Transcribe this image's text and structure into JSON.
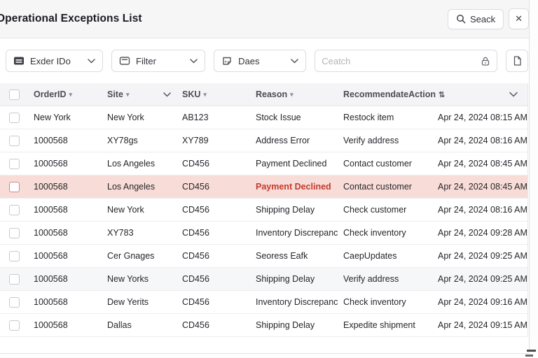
{
  "header": {
    "title": "Operational Exceptions List",
    "search_button": "Seack",
    "close_button": "✕"
  },
  "toolbar": {
    "dropdowns": [
      {
        "label": "Exder IDo",
        "icon": "list-icon"
      },
      {
        "label": "Filter",
        "icon": "filter-icon"
      },
      {
        "label": "Daes",
        "icon": "note-icon"
      }
    ],
    "search": {
      "placeholder": "Ceatch",
      "trailing_icon": "lock-icon"
    },
    "copy_button_icon": "file-icon"
  },
  "table": {
    "columns": [
      {
        "label": "OrderID",
        "sort": "▾"
      },
      {
        "label": "Site",
        "sort": "▾",
        "chevron": true
      },
      {
        "label": "SKU",
        "sort": "▾"
      },
      {
        "label": "Reason",
        "sort": "▾"
      },
      {
        "label": "RecommendateAction",
        "sort": "⇅"
      },
      {
        "label": "",
        "chevron": true
      }
    ],
    "rows": [
      {
        "order_id": "New York",
        "site": "New York",
        "sku": "AB123",
        "reason": "Stock Issue",
        "action": "Restock item",
        "timestamp": "Apr 24, 2024 08:15 AM",
        "highlight": false,
        "shaded": false
      },
      {
        "order_id": "1000568",
        "site": "XY78gs",
        "sku": "XY789",
        "reason": "Address Error",
        "action": "Verify address",
        "timestamp": "Apr 24, 2024 08:16 AM",
        "highlight": false,
        "shaded": false
      },
      {
        "order_id": "1000568",
        "site": "Los Angeles",
        "sku": "CD456",
        "reason": "Payment Declined",
        "action": "Contact customer",
        "timestamp": "Apr 24, 2024 08:45 AM",
        "highlight": false,
        "shaded": false
      },
      {
        "order_id": "1000568",
        "site": "Los Angeles",
        "sku": "CD456",
        "reason": "Payment Declined",
        "action": "Contact customer",
        "timestamp": "Apr 24, 2024 08:45 AM",
        "highlight": true,
        "shaded": false
      },
      {
        "order_id": "1000568",
        "site": "New York",
        "sku": "CD456",
        "reason": "Shipping Delay",
        "action": "Check customer",
        "timestamp": "Apr 24, 2024 08:16 AM",
        "highlight": false,
        "shaded": false
      },
      {
        "order_id": "1000568",
        "site": "XY783",
        "sku": "CD456",
        "reason": "Inventory Discrepancy",
        "action": "Check inventory",
        "timestamp": "Apr 24, 2024 09:28 AM",
        "highlight": false,
        "shaded": false
      },
      {
        "order_id": "1000568",
        "site": "Cer Gnages",
        "sku": "CD456",
        "reason": "Seoress Eafk",
        "action": "CaepUpdates",
        "timestamp": "Apr 24, 2024 09:25 AM",
        "highlight": false,
        "shaded": false
      },
      {
        "order_id": "1000568",
        "site": "New Yorks",
        "sku": "CD456",
        "reason": "Shipping Delay",
        "action": "Verify address",
        "timestamp": "Apr 24, 2024 09:25 AM",
        "highlight": false,
        "shaded": true
      },
      {
        "order_id": "1000568",
        "site": "Dew Yerits",
        "sku": "CD456",
        "reason": "Inventory Discrepancy",
        "action": "Check inventory",
        "timestamp": "Apr 24, 2024 09:16 AM",
        "highlight": false,
        "shaded": false
      },
      {
        "order_id": "1000568",
        "site": "Dallas",
        "sku": "CD456",
        "reason": "Shipping Delay",
        "action": "Expedite shipment",
        "timestamp": "Apr 24, 2024 09:15 AM",
        "highlight": false,
        "shaded": false
      }
    ]
  },
  "colors": {
    "highlight_row_bg": "#f8dcd7",
    "highlight_text": "#c43a2d",
    "topbar_bg": "#f6f6f7",
    "table_header_bg": "#f4f4f6",
    "border": "#e7e7ea"
  }
}
